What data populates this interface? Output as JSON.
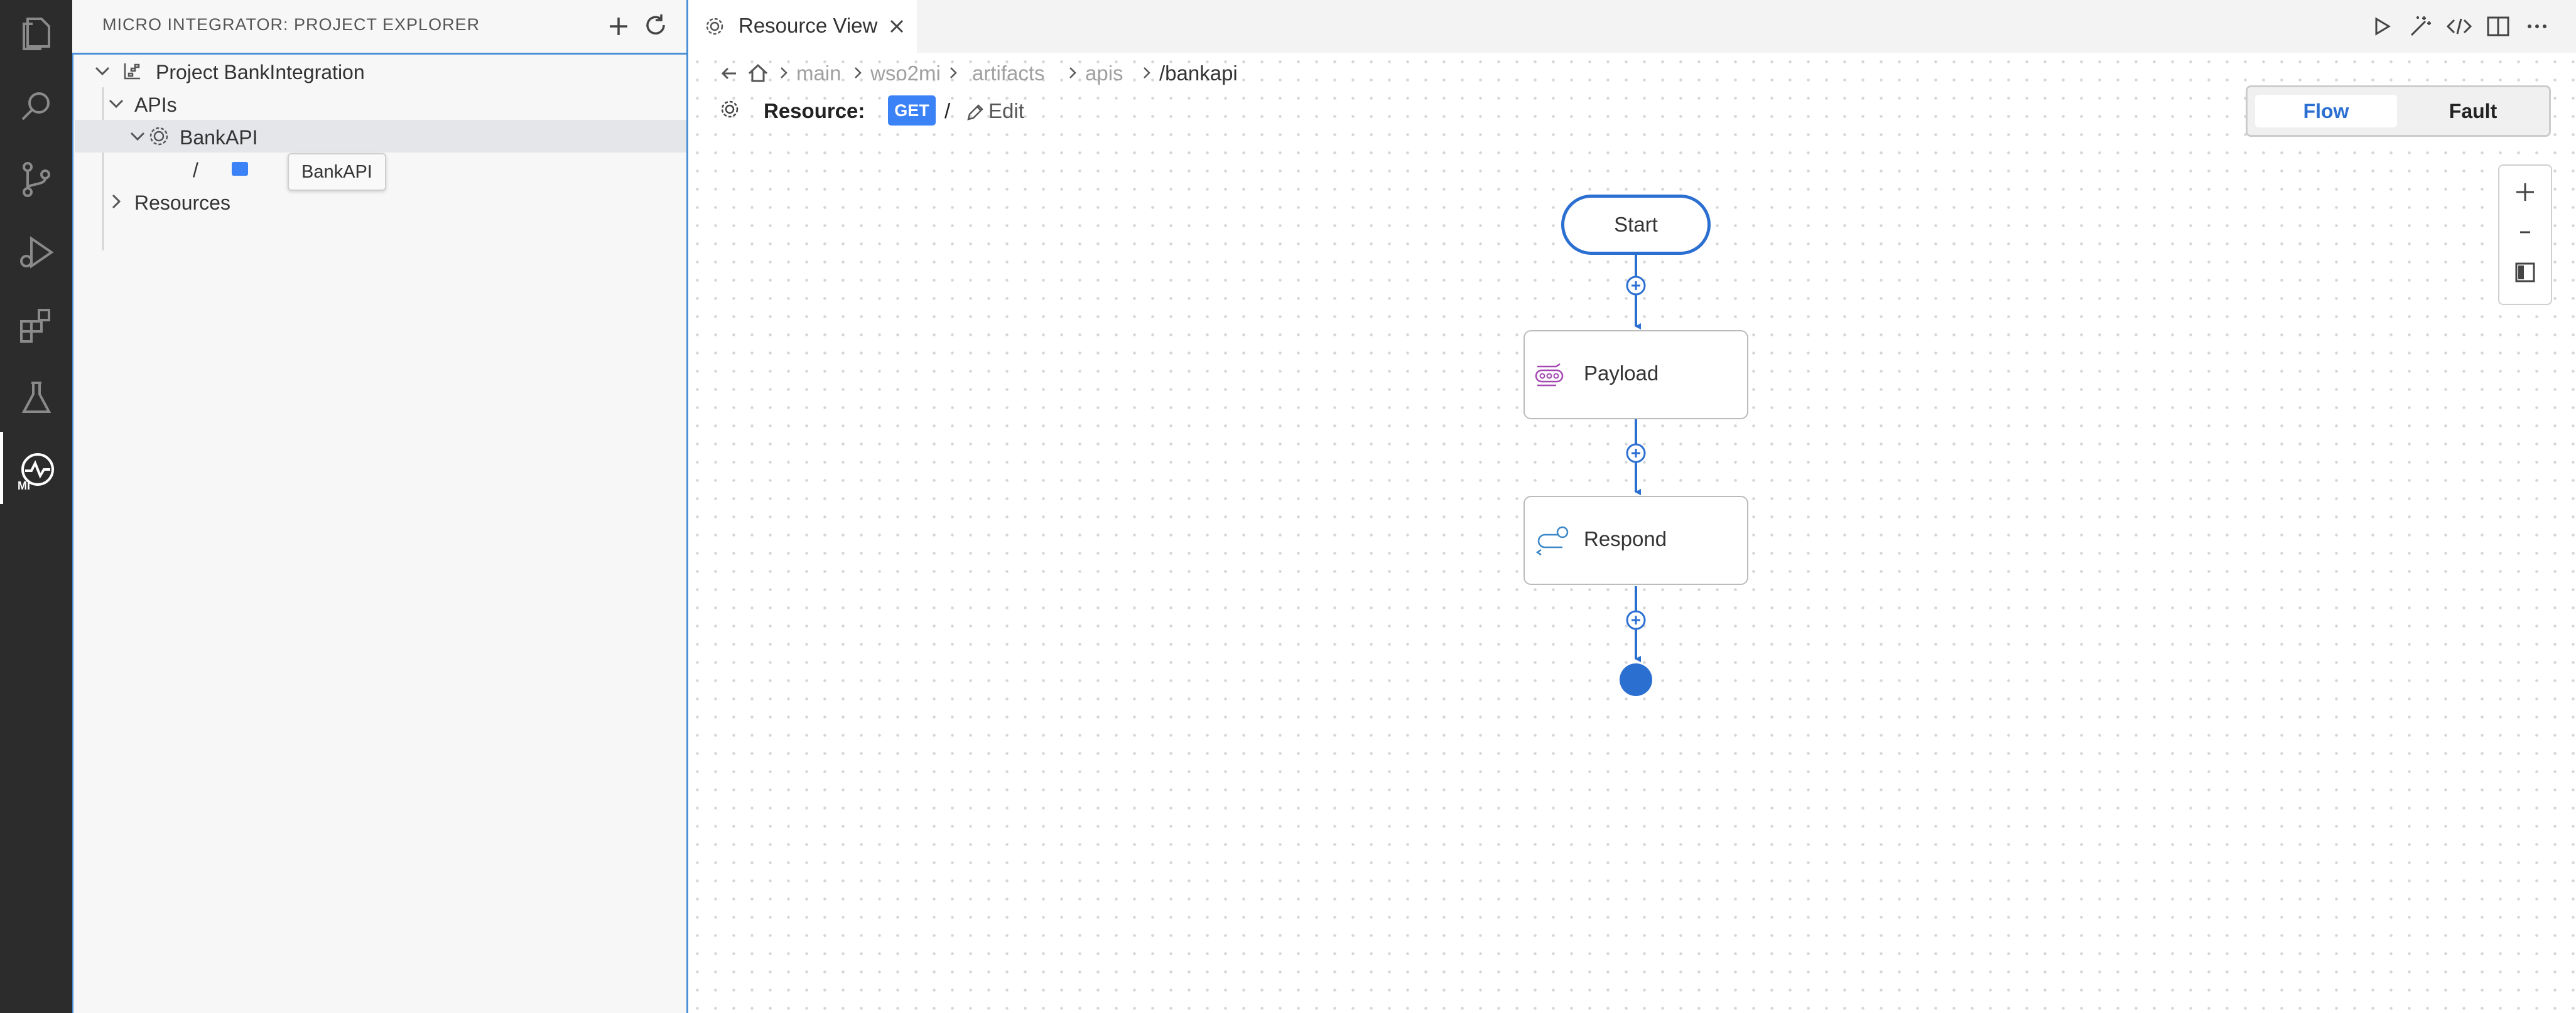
{
  "activity_bar": {
    "items": [
      "explorer-icon",
      "search-icon",
      "source-control-icon",
      "run-debug-icon",
      "extensions-icon",
      "testing-icon",
      "micro-integrator-icon"
    ],
    "active": "micro-integrator-icon",
    "mi_badge": "MI"
  },
  "sidebar": {
    "title": "MICRO INTEGRATOR: PROJECT EXPLORER",
    "actions": [
      "add-icon",
      "refresh-icon"
    ],
    "tree": {
      "project": "Project BankIntegration",
      "apis": "APIs",
      "api": "BankAPI",
      "resource_path": "/",
      "resources": "Resources"
    },
    "tooltip": "BankAPI"
  },
  "tabs": [
    {
      "label": "Resource View",
      "active": true
    }
  ],
  "toolbar": [
    "run-icon",
    "wand-icon",
    "code-icon",
    "split-editor-icon",
    "more-icon"
  ],
  "breadcrumb": [
    "main",
    "wso2mi",
    "artifacts",
    "apis",
    "/bankapi"
  ],
  "resource": {
    "label": "Resource:",
    "method": "GET",
    "path": "/",
    "edit_label": "Edit"
  },
  "view_toggle": {
    "options": [
      "Flow",
      "Fault"
    ],
    "selected": "Flow"
  },
  "zoom_controls": [
    "zoom-in-icon",
    "zoom-out-icon",
    "fit-icon"
  ],
  "flow": {
    "start_label": "Start",
    "nodes": [
      {
        "label": "Payload",
        "icon": "payload-icon"
      },
      {
        "label": "Respond",
        "icon": "respond-icon"
      }
    ]
  },
  "colors": {
    "accent": "#2b6fd1",
    "method_badge": "#3b82f6",
    "highlight_ring": "#e0452e",
    "payload_icon": "#a445b2",
    "respond_icon": "#3a86c8"
  }
}
